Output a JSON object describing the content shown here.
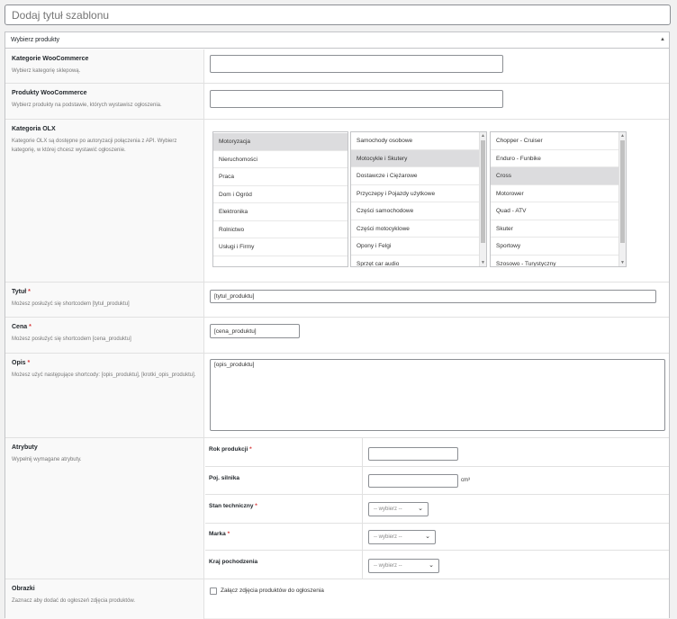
{
  "template_title": {
    "placeholder": "Dodaj tytuł szablonu"
  },
  "metabox": {
    "title": "Wybierz produkty",
    "toggle_icon": "triangle-up-icon"
  },
  "rows": {
    "woo_categories": {
      "label": "Kategorie WooCommerce",
      "desc": "Wybierz kategorię sklepową.",
      "value": ""
    },
    "woo_products": {
      "label": "Produkty WooCommerce",
      "desc": "Wybierz produkty na podstawie, których wystawisz ogłoszenia.",
      "value": ""
    },
    "olx_category": {
      "label": "Kategoria OLX",
      "desc": "Kategorie OLX są dostępne po autoryzacji połączenia z API. Wybierz kategorię, w której chcesz wystawić ogłoszenie.",
      "list1": [
        "Motoryzacja",
        "Nieruchomości",
        "Praca",
        "Dom i Ogród",
        "Elektronika",
        "Rolnictwo",
        "Usługi i Firmy"
      ],
      "list2": [
        "Samochody osobowe",
        "Motocykle i Skutery",
        "Dostawcze i Ciężarowe",
        "Przyczepy i Pojazdy użytkowe",
        "Części samochodowe",
        "Części motocyklowe",
        "Opony i Felgi",
        "Sprzęt car audio"
      ],
      "list3": [
        "Chopper - Cruiser",
        "Enduro - Funbike",
        "Cross",
        "Motorower",
        "Quad - ATV",
        "Skuter",
        "Sportowy",
        "Szosowo - Turystyczny"
      ]
    },
    "title": {
      "label": "Tytuł",
      "required": "*",
      "desc": "Możesz posłużyć się shortcodem [tytul_produktu]",
      "value": "[tytul_produktu]"
    },
    "price": {
      "label": "Cena",
      "required": "*",
      "desc": "Możesz posłużyć się shortcodem [cena_produktu]",
      "value": "[cena_produktu]"
    },
    "description": {
      "label": "Opis",
      "required": "*",
      "desc": "Możesz użyć następujące shortcody: [opis_produktu], [krotki_opis_produktu].",
      "value": "[opis_produktu]"
    },
    "attributes": {
      "label": "Atrybuty",
      "desc": "Wypełnij wymagane atrybuty.",
      "year": {
        "label": "Rok produkcji",
        "required": "*",
        "value": ""
      },
      "engine": {
        "label": "Poj. silnika",
        "value": "",
        "unit": "cm³"
      },
      "condition": {
        "label": "Stan techniczny",
        "required": "*",
        "value": "-- wybierz --"
      },
      "brand": {
        "label": "Marka",
        "required": "*",
        "value": "-- wybierz --"
      },
      "origin": {
        "label": "Kraj pochodzenia",
        "value": "-- wybierz --"
      }
    },
    "images": {
      "label": "Obrazki",
      "desc": "Zaznacz aby dodać do ogłoszeń zdjęcia produktów.",
      "checkbox_label": "Załącz zdjęcia produktów do ogłoszenia"
    }
  }
}
